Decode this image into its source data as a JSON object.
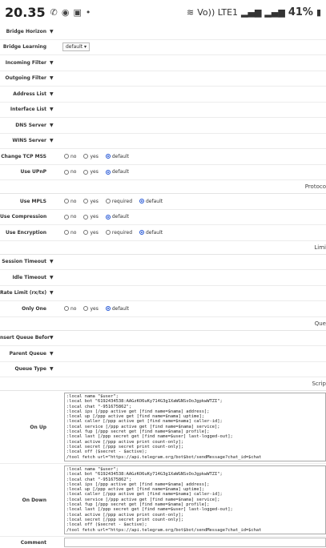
{
  "status_bar": {
    "time": "20.35",
    "net": "Vo)) LTE1",
    "battery": "41%"
  },
  "fields": [
    {
      "label": "Bridge Horizon",
      "kind": "arrow"
    },
    {
      "label": "Bridge Learning",
      "kind": "select",
      "value": "default"
    },
    {
      "label": "Incoming Filter",
      "kind": "arrow"
    },
    {
      "label": "Outgoing Filter",
      "kind": "arrow"
    },
    {
      "label": "Address List",
      "kind": "arrow"
    },
    {
      "label": "Interface List",
      "kind": "arrow"
    },
    {
      "label": "DNS Server",
      "kind": "arrow"
    },
    {
      "label": "WINS Server",
      "kind": "arrow"
    },
    {
      "label": "Change TCP MSS",
      "kind": "radio",
      "options": [
        "no",
        "yes",
        "default"
      ],
      "selected": "default"
    },
    {
      "label": "Use UPnP",
      "kind": "radio",
      "options": [
        "no",
        "yes",
        "default"
      ],
      "selected": "default"
    }
  ],
  "sections": {
    "protocols": "Protoco",
    "limits": "Limi",
    "queues": "Que",
    "scripts": "Scrip"
  },
  "protocol_fields": [
    {
      "label": "Use MPLS",
      "options": [
        "no",
        "yes",
        "required",
        "default"
      ],
      "selected": "default"
    },
    {
      "label": "Use Compression",
      "options": [
        "no",
        "yes",
        "default"
      ],
      "selected": "default"
    },
    {
      "label": "Use Encryption",
      "options": [
        "no",
        "yes",
        "required",
        "default"
      ],
      "selected": "default"
    }
  ],
  "limit_fields": [
    {
      "label": "Session Timeout"
    },
    {
      "label": "Idle Timeout"
    },
    {
      "label": "Rate Limit (rx/tx)"
    }
  ],
  "only_one": {
    "label": "Only One",
    "options": [
      "no",
      "yes",
      "default"
    ],
    "selected": "default"
  },
  "queue_fields": [
    {
      "label": "nsert Queue Before"
    },
    {
      "label": "Parent Queue"
    },
    {
      "label": "Queue Type"
    }
  ],
  "on_up": {
    "label": "On Up",
    "script": ":local nama \"$user\";\n:local bot \"6192434538:AAGzKO6uKy714G3g1XaWGNSsOoJgpkwWTZI\";\n:local chat \"-951675862\";\n:local ips [/ppp active get [find name=$nama] address];\n:local up [/ppp active get [find name=$nama] uptime];\n:local caller [/ppp active get [find name=$nama] caller-id];\n:local service [/ppp active get [find name=$nama] service];\n:local fup [/ppp secret get [find name=$nama] profile];\n:local last [/ppp secret get [find name=$user] last-logged-out];\n:local active [/ppp active print count-only];\n:local secret [/ppp secret print count-only];\n:local off ($secret - $active);\n/tool fetch url=\"https://api.telegram.org/bot$bot/sendMessage?chat_id=$chat"
  },
  "on_down": {
    "label": "On Down",
    "script": ":local nama \"$user\";\n:local bot \"6192434538:AAGzKO6uKy714G3g1XaWGNSsOoJgpkwWTZI\";\n:local chat \"-951675862\";\n:local ips [/ppp active get [find name=$nama] address];\n:local up [/ppp active get [find name=$nama] uptime];\n:local caller [/ppp active get [find name=$nama] caller-id];\n:local service [/ppp active get [find name=$nama] service];\n:local fup [/ppp secret get [find name=$nama] profile];\n:local last [/ppp secret get [find name=$user] last-logged-out];\n:local active [/ppp active print count-only];\n:local secret [/ppp secret print count-only];\n:local off ($secret - $active);\n/tool fetch url=\"https://api.telegram.org/bot$bot/sendMessage?chat_id=$chat"
  },
  "comment": {
    "label": "Comment",
    "value": ""
  },
  "arrow_glyph": "▼",
  "select_glyph": "▾"
}
